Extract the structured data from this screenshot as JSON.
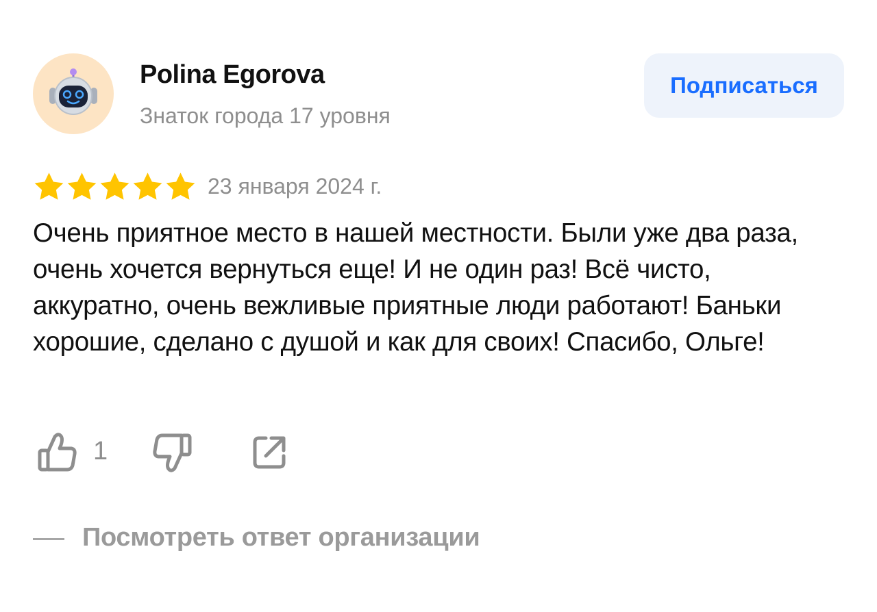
{
  "author": {
    "name": "Polina Egorova",
    "level": "Знаток города 17 уровня",
    "avatar_icon": "robot-avatar-icon"
  },
  "subscribe_label": "Подписаться",
  "rating": {
    "stars": 5,
    "max": 5,
    "date": "23 января 2024 г."
  },
  "review_text": "Очень приятное место в нашей местности. Были уже два раза, очень хочется вернуться еще! И не один раз! Всё чисто, аккуратно, очень вежливые приятные люди работают! Баньки хорошие, сделано с душой и как для своих! Спасибо, Ольге!",
  "actions": {
    "like_count": "1",
    "like_icon": "thumbs-up-icon",
    "dislike_icon": "thumbs-down-icon",
    "share_icon": "share-icon"
  },
  "reply_toggle": "Посмотреть ответ организации",
  "colors": {
    "accent": "#196dff",
    "star": "#ffc400",
    "muted": "#8e8e8e",
    "button_bg": "#eef3fb",
    "avatar_bg": "#fde4c4"
  }
}
